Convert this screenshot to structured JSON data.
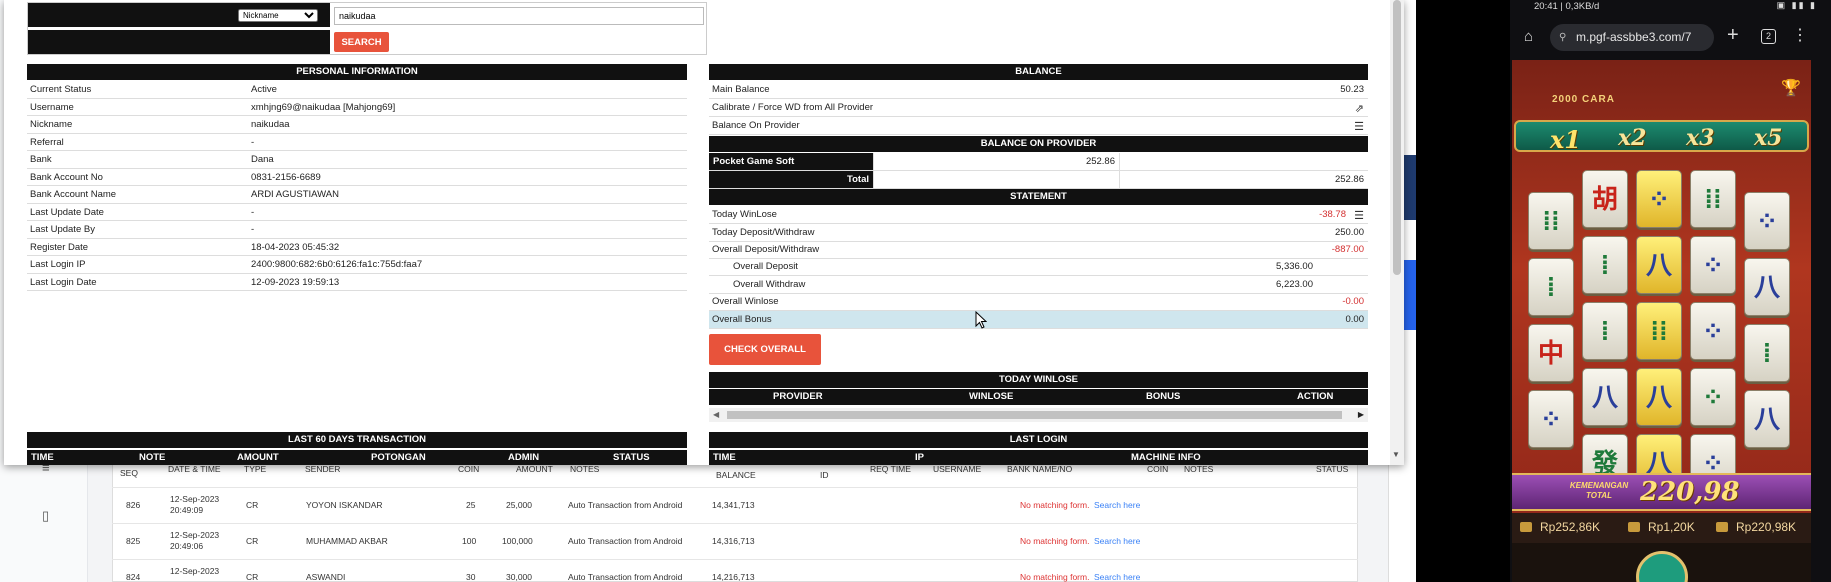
{
  "search": {
    "field_option": "Nickname",
    "value": "naikudaa",
    "button": "SEARCH"
  },
  "personal": {
    "title": "PERSONAL INFORMATION",
    "rows": [
      {
        "k": "Current Status",
        "v": "Active"
      },
      {
        "k": "Username",
        "v": "xmhjng69@naikudaa  [Mahjong69]"
      },
      {
        "k": "Nickname",
        "v": "naikudaa"
      },
      {
        "k": "Referral",
        "v": "-"
      },
      {
        "k": "Bank",
        "v": "Dana"
      },
      {
        "k": "Bank Account No",
        "v": "0831-2156-6689"
      },
      {
        "k": "Bank Account Name",
        "v": "ARDI AGUSTIAWAN"
      },
      {
        "k": "Last Update Date",
        "v": "-"
      },
      {
        "k": "Last Update By",
        "v": "-"
      },
      {
        "k": "Register Date",
        "v": "18-04-2023 05:45:32"
      },
      {
        "k": "Last Login IP",
        "v": "2400:9800:682:6b0:6126:fa1c:755d:faa7"
      },
      {
        "k": "Last Login Date",
        "v": "12-09-2023 19:59:13"
      }
    ]
  },
  "balance": {
    "title": "BALANCE",
    "main_label": "Main Balance",
    "main_value": "50.23",
    "calibrate_label": "Calibrate / Force WD from All Provider",
    "on_provider_label": "Balance On Provider"
  },
  "balance_on_provider": {
    "title": "BALANCE ON PROVIDER",
    "provider": "Pocket Game Soft",
    "provider_value": "252.86",
    "total_label": "Total",
    "total_value": "252.86"
  },
  "statement": {
    "title": "STATEMENT",
    "today_winlose_label": "Today WinLose",
    "today_winlose": "-38.78",
    "today_dw_label": "Today Deposit/Withdraw",
    "today_dw": "250.00",
    "overall_dw_label": "Overall Deposit/Withdraw",
    "overall_dw": "-887.00",
    "overall_deposit_label": "Overall Deposit",
    "overall_deposit": "5,336.00",
    "overall_withdraw_label": "Overall Withdraw",
    "overall_withdraw": "6,223.00",
    "overall_winlose_label": "Overall Winlose",
    "overall_winlose": "-0.00",
    "overall_bonus_label": "Overall Bonus",
    "overall_bonus": "0.00",
    "check_button": "CHECK OVERALL"
  },
  "today_winlose": {
    "title": "TODAY WINLOSE",
    "cols": [
      "PROVIDER",
      "WINLOSE",
      "BONUS",
      "ACTION"
    ]
  },
  "last60": {
    "title": "LAST 60 DAYS TRANSACTION",
    "cols": [
      "TIME",
      "NOTE",
      "AMOUNT",
      "POTONGAN",
      "ADMIN",
      "STATUS"
    ]
  },
  "last_login": {
    "title": "LAST LOGIN",
    "cols": [
      "TIME",
      "IP",
      "MACHINE INFO"
    ]
  },
  "bg_table": {
    "headers": [
      "SEQ",
      "DATE & TIME",
      "TYPE",
      "SENDER",
      "COIN",
      "AMOUNT",
      "NOTES",
      "BALANCE",
      "ID",
      "REQ TIME",
      "USERNAME",
      "BANK NAME/NO",
      "COIN",
      "NOTES",
      "STATUS"
    ],
    "rows": [
      {
        "seq": "826",
        "date": "12-Sep-2023",
        "time": "20:49:09",
        "type": "CR",
        "sender": "YOYON ISKANDAR",
        "coin": "25",
        "amount": "25,000",
        "notes": "Auto Transaction from Android",
        "balance": "14,341,713"
      },
      {
        "seq": "825",
        "date": "12-Sep-2023",
        "time": "20:49:06",
        "type": "CR",
        "sender": "MUHAMMAD AKBAR",
        "coin": "100",
        "amount": "100,000",
        "notes": "Auto Transaction from Android",
        "balance": "14,316,713"
      },
      {
        "seq": "824",
        "date": "12-Sep-2023",
        "time": "",
        "type": "CR",
        "sender": "ASWANDI",
        "coin": "30",
        "amount": "30,000",
        "notes": "Auto Transaction from Android",
        "balance": "14,216,713"
      }
    ],
    "no_match": "No matching form.",
    "search_here": "Search here"
  },
  "phone": {
    "status_left": "20:41 | 0,3KB/d",
    "url": "m.pgf-assbbe3.com/7",
    "tab_count": "2",
    "combo": "2000 CARA",
    "multipliers": [
      "x1",
      "x2",
      "x3",
      "x5"
    ],
    "win_label": "KEMENANGAN TOTAL",
    "win_value": "220,98",
    "balance": "Rp252,86K",
    "bet": "Rp1,20K",
    "win": "Rp220,98K"
  }
}
